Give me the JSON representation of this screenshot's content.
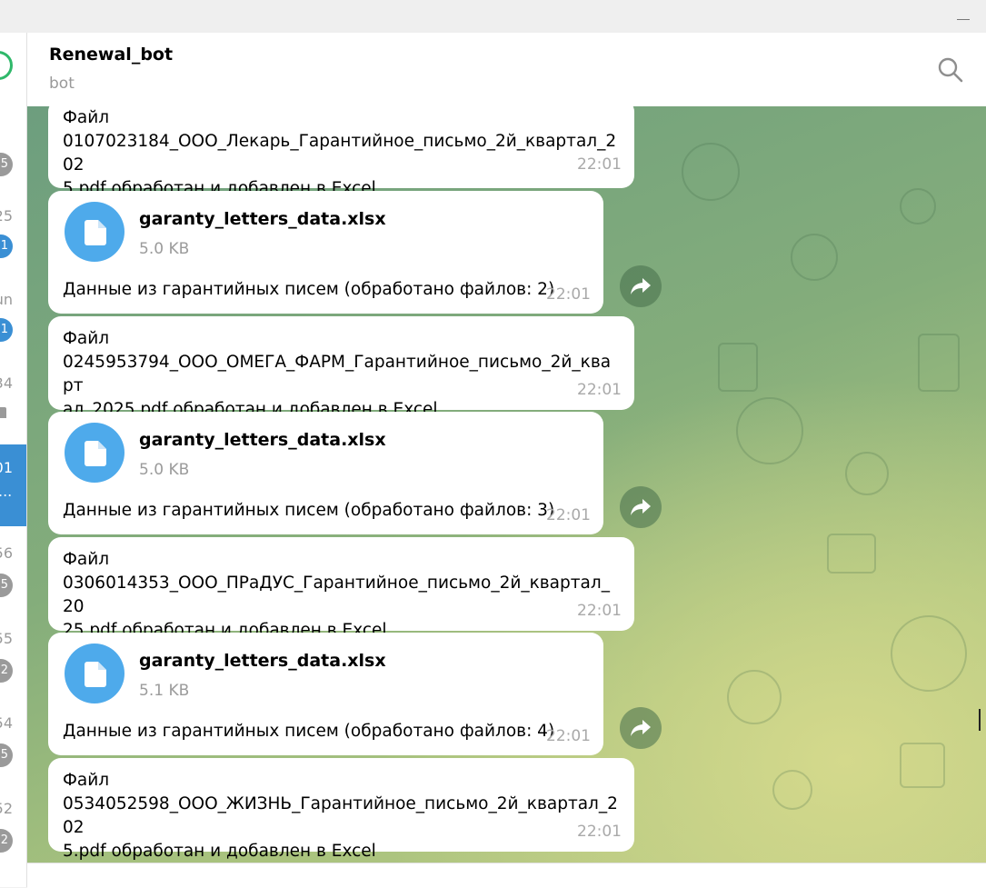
{
  "left_strip": {
    "items": [
      {
        "time": "",
        "badge": "5"
      },
      {
        "time": "25",
        "badge": "1"
      },
      {
        "time": "un",
        "badge": "1"
      },
      {
        "time": "34",
        "pinned": true
      },
      {
        "time": "01",
        "snippet": "..."
      },
      {
        "time": "56",
        "badge": "5"
      },
      {
        "time": "55",
        "badge": "2"
      },
      {
        "time": "54",
        "badge": "5"
      },
      {
        "time": "52",
        "badge": "2"
      }
    ]
  },
  "header": {
    "title": "Renewal_bot",
    "status": "bot",
    "search_icon": "search-icon"
  },
  "messages": [
    {
      "type": "text",
      "text": "Файл 0107023184_ООО_Лекарь_Гарантийное_письмо_2й_квартал_2025.pdf обработан и добавлен в Excel",
      "line1": "Файл",
      "line2": "0107023184_ООО_Лекарь_Гарантийное_письмо_2й_квартал_202",
      "line3": "5.pdf обработан и добавлен в Excel",
      "time": "22:01"
    },
    {
      "type": "file",
      "file_name": "garanty_letters_data.xlsx",
      "file_size": "5.0 KB",
      "caption": "Данные из гарантийных писем (обработано файлов: 2)",
      "time": "22:01"
    },
    {
      "type": "text",
      "line1": "Файл",
      "line2": "0245953794_ООО_ОМЕГА_ФАРМ_Гарантийное_письмо_2й_кварт",
      "line3": "ал_2025.pdf обработан и добавлен в Excel",
      "time": "22:01"
    },
    {
      "type": "file",
      "file_name": "garanty_letters_data.xlsx",
      "file_size": "5.0 KB",
      "caption": "Данные из гарантийных писем (обработано файлов: 3)",
      "time": "22:01"
    },
    {
      "type": "text",
      "line1": "Файл",
      "line2": "0306014353_ООО_ПРаДУС_Гарантийное_письмо_2й_квартал_20",
      "line3": "25.pdf обработан и добавлен в Excel",
      "time": "22:01"
    },
    {
      "type": "file",
      "file_name": "garanty_letters_data.xlsx",
      "file_size": "5.1 KB",
      "caption": "Данные из гарантийных писем (обработано файлов: 4)",
      "time": "22:01"
    },
    {
      "type": "text",
      "line1": "Файл",
      "line2": "0534052598_ООО_ЖИЗНЬ_Гарантийное_письмо_2й_квартал_202",
      "line3": "5.pdf обработан и добавлен в Excel",
      "time": "22:01"
    }
  ],
  "colors": {
    "accent": "#4eaaeb",
    "active_chat": "#3a8fd4",
    "bubble": "#ffffff",
    "time": "#a9a9a9"
  }
}
